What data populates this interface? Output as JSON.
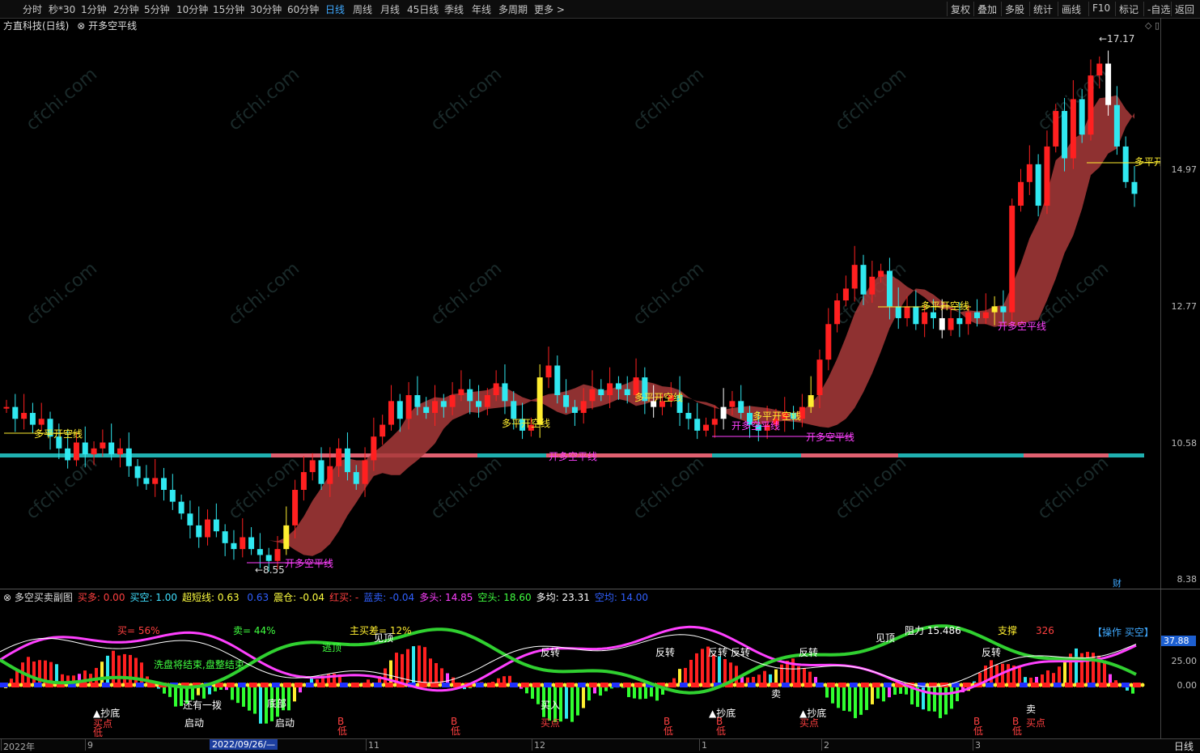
{
  "toolbar": {
    "periods": [
      "分时",
      "秒*30",
      "1分钟",
      "2分钟",
      "5分钟",
      "10分钟",
      "15分钟",
      "30分钟",
      "60分钟",
      "日线",
      "周线",
      "月线",
      "45日线",
      "季线",
      "年线",
      "多周期",
      "更多 >"
    ],
    "active": "日线",
    "right": [
      "复权",
      "叠加",
      "多股",
      "统计",
      "画线",
      "F10",
      "标记",
      "-自选",
      "返回"
    ]
  },
  "main": {
    "title": "方直科技(日线)",
    "indicator": "开多空平线",
    "price_labels": [
      "14.97",
      "12.77",
      "10.58",
      "8.38"
    ],
    "high": "17.17",
    "low": "8.55",
    "annotations": {
      "dpk": "多平开空线",
      "kdk": "开多空平线"
    }
  },
  "sub": {
    "name": "多空买卖副图",
    "values": [
      {
        "label": "买多:",
        "value": "0.00",
        "color": "#ff4040"
      },
      {
        "label": "买空:",
        "value": "1.00",
        "color": "#40e0ff"
      },
      {
        "label": "超短线:",
        "value": "0.63",
        "color": "#ffff40"
      },
      {
        "label": "",
        "value": "0.63",
        "color": "#3060ff"
      },
      {
        "label": "震仓:",
        "value": "-0.04",
        "color": "#ffff40"
      },
      {
        "label": "红买:",
        "value": "-",
        "color": "#ff4040"
      },
      {
        "label": "蓝卖:",
        "value": "-0.04",
        "color": "#3060ff"
      },
      {
        "label": "多头:",
        "value": "14.85",
        "color": "#ff40ff"
      },
      {
        "label": "空头:",
        "value": "18.60",
        "color": "#40ff40"
      },
      {
        "label": "多均:",
        "value": "23.31",
        "color": "#ffffff"
      },
      {
        "label": "空均:",
        "value": "14.00",
        "color": "#3060ff"
      }
    ],
    "axis_labels": [
      "25.00",
      "0.00"
    ],
    "current": "37.88",
    "operation": "【操作 买空】",
    "texts": {
      "buy_pct": "买= 56%",
      "sell_pct": "卖= 44%",
      "main_diff": "主买差= 12%",
      "resist": "阻力 15.486",
      "support": "支撑",
      "support_val": "326",
      "escape": "逃顶",
      "peak": "见顶",
      "reverse": "反转",
      "wash": "洗盘将结束,盘整结束",
      "bottom": "抄底",
      "buypoint": "买点",
      "start": "启动",
      "low": "低",
      "b": "B",
      "buyin": "买入",
      "sell": "卖",
      "boom": "还有一拨",
      "bottom2": "底部",
      "dibu": "底"
    }
  },
  "axis": {
    "dates": [
      "2022年",
      "9",
      "11",
      "12",
      "1",
      "2",
      "3"
    ],
    "cursor_date": "2022/09/26/—",
    "period": "日线"
  },
  "misc": {
    "cai": "财"
  },
  "chart_data": {
    "type": "candlestick",
    "title": "方直科技(日线)",
    "ylim": [
      8.2,
      17.5
    ],
    "yticks": [
      14.97,
      12.77,
      10.58,
      8.38
    ],
    "annotations": {
      "max": 17.17,
      "min": 8.55
    },
    "series": [
      {
        "name": "close",
        "values": [
          11.2,
          11.0,
          11.1,
          10.9,
          11.0,
          10.7,
          10.5,
          10.3,
          10.6,
          10.4,
          10.5,
          10.6,
          10.4,
          10.5,
          10.2,
          10.0,
          9.9,
          10.0,
          9.8,
          9.6,
          9.4,
          9.2,
          9.0,
          9.3,
          9.1,
          8.9,
          8.8,
          9.0,
          8.8,
          8.7,
          8.6,
          8.8,
          9.2,
          9.8,
          10.1,
          10.3,
          9.9,
          10.2,
          10.5,
          10.1,
          9.9,
          10.3,
          10.7,
          10.9,
          11.3,
          11.0,
          11.4,
          11.2,
          11.1,
          11.3,
          11.2,
          11.4,
          11.5,
          11.3,
          11.2,
          11.4,
          11.6,
          11.3,
          11.0,
          10.8,
          10.9,
          11.7,
          11.9,
          11.4,
          11.2,
          11.1,
          11.3,
          11.5,
          11.4,
          11.6,
          11.5,
          11.4,
          11.7,
          11.3,
          11.2,
          11.3,
          11.4,
          11.1,
          11.0,
          10.8,
          10.9,
          11.0,
          11.2,
          11.3,
          11.1,
          10.9,
          10.8,
          10.9,
          11.0,
          11.1,
          11.0,
          11.2,
          11.4,
          12.0,
          12.6,
          13.0,
          13.2,
          13.6,
          13.1,
          13.4,
          13.5,
          12.9,
          12.7,
          12.9,
          12.6,
          12.8,
          12.7,
          12.5,
          12.7,
          12.6,
          12.8,
          12.7,
          12.8,
          12.9,
          12.8,
          14.6,
          15.0,
          15.3,
          14.6,
          15.6,
          16.2,
          15.4,
          16.4,
          15.8,
          16.8,
          17.0,
          16.3,
          15.6,
          15.0,
          14.8
        ]
      }
    ]
  }
}
